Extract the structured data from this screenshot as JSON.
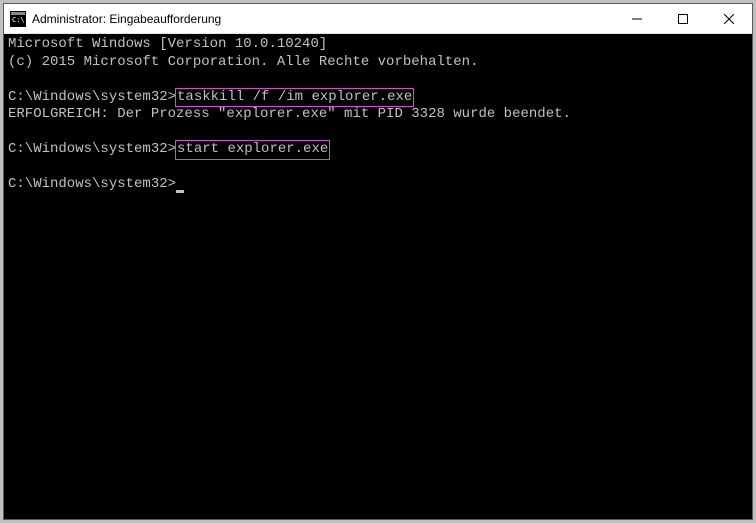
{
  "titlebar": {
    "title": "Administrator: Eingabeaufforderung"
  },
  "terminal": {
    "line1": "Microsoft Windows [Version 10.0.10240]",
    "line2": "(c) 2015 Microsoft Corporation. Alle Rechte vorbehalten.",
    "prompt1": "C:\\Windows\\system32>",
    "command1": "taskkill /f /im explorer.exe",
    "result1": "ERFOLGREICH: Der Prozess \"explorer.exe\" mit PID 3328 wurde beendet.",
    "prompt2": "C:\\Windows\\system32>",
    "command2": "start explorer.exe",
    "prompt3": "C:\\Windows\\system32>"
  }
}
